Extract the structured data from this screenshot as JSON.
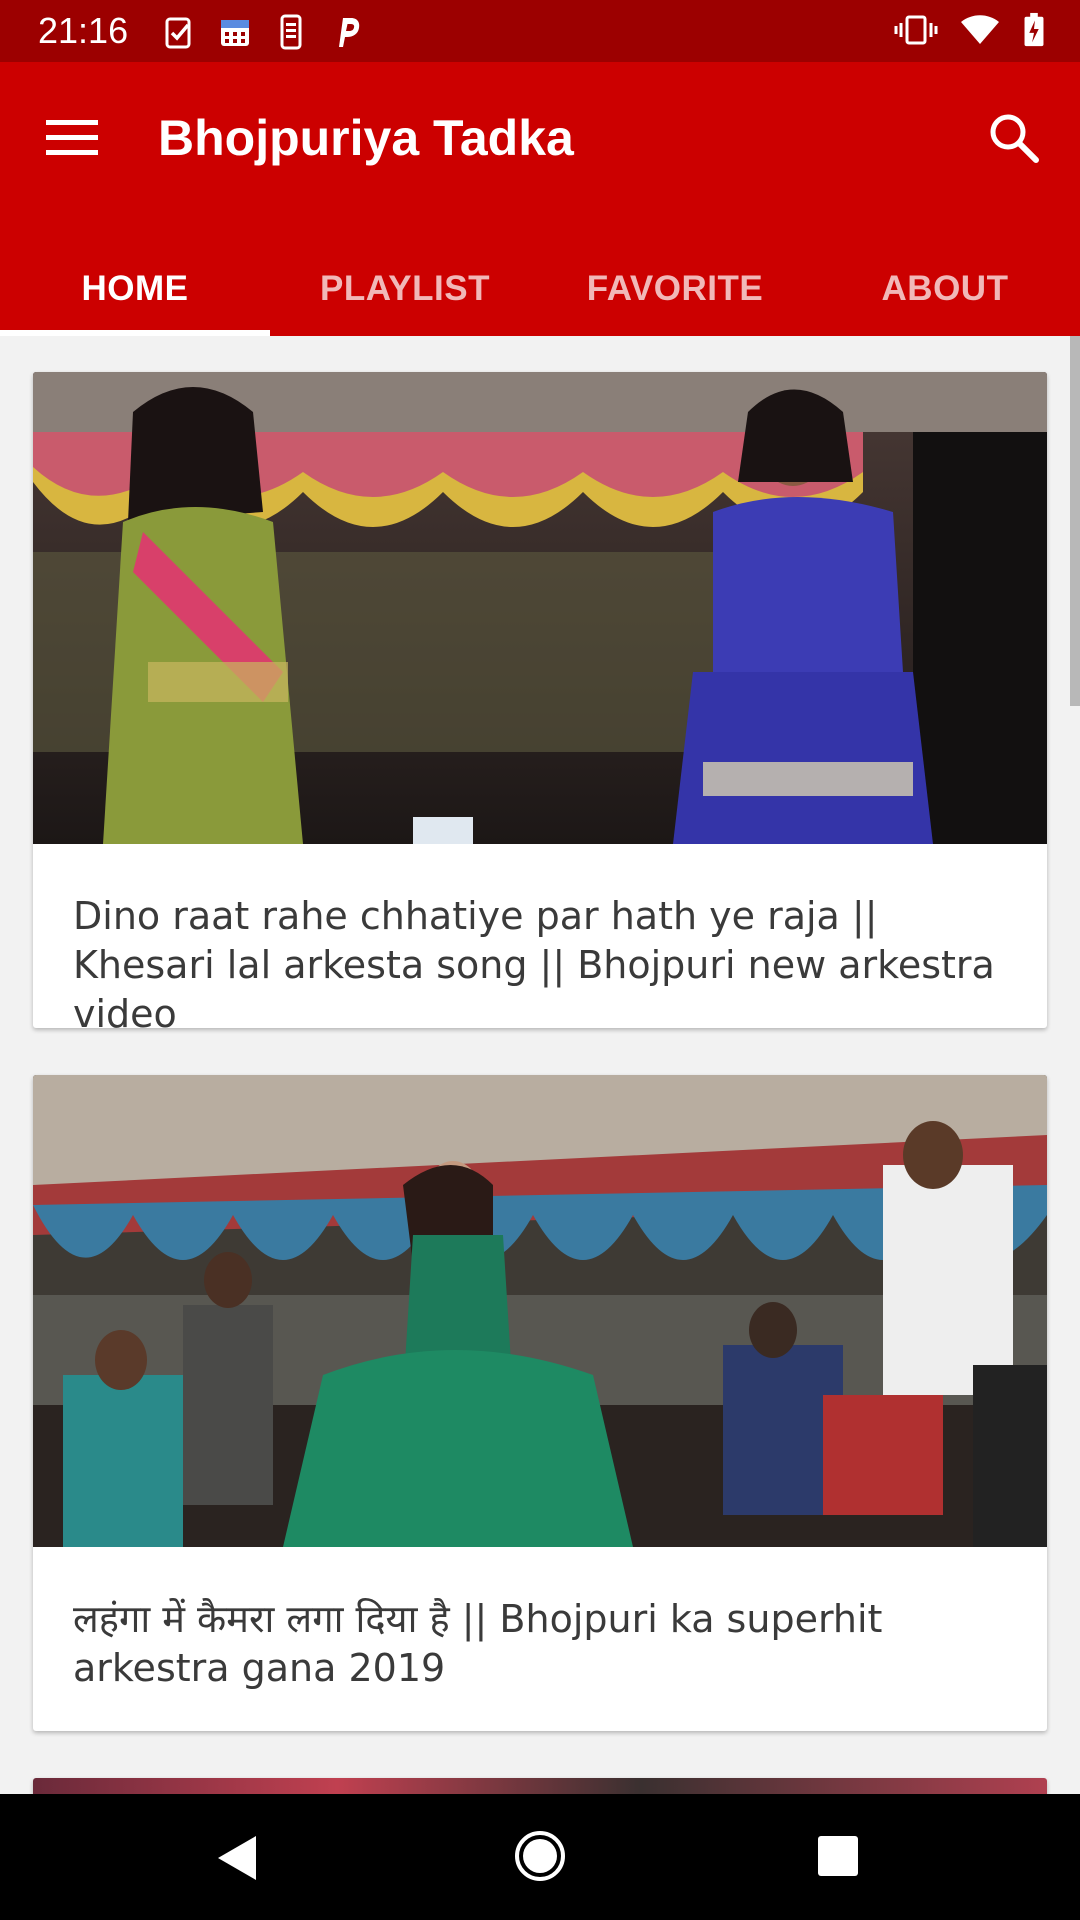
{
  "status_bar": {
    "time": "21:16",
    "left_icons": [
      "task-check-icon",
      "calendar-icon",
      "phone-screen-icon",
      "p-app-icon"
    ],
    "right_icons": [
      "vibrate-icon",
      "wifi-icon",
      "battery-charging-icon"
    ]
  },
  "app_bar": {
    "title": "Bhojpuriya Tadka",
    "menu_icon": "hamburger-menu-icon",
    "search_icon": "search-icon",
    "color": "#cc0000",
    "status_color": "#9c0000"
  },
  "tabs": [
    {
      "label": "HOME",
      "active": true
    },
    {
      "label": "PLAYLIST",
      "active": false
    },
    {
      "label": "FAVORITE",
      "active": false
    },
    {
      "label": "ABOUT",
      "active": false
    }
  ],
  "videos": [
    {
      "title": "Dino raat rahe chhatiye par hath ye raja || Khesari lal arkesta song || Bhojpuri new arkestra video"
    },
    {
      "title": "लहंगा में कैमरा लगा दिया है || Bhojpuri ka superhit arkestra gana 2019"
    }
  ],
  "nav_bar": {
    "icons": [
      "back-icon",
      "home-icon",
      "recents-icon"
    ]
  }
}
